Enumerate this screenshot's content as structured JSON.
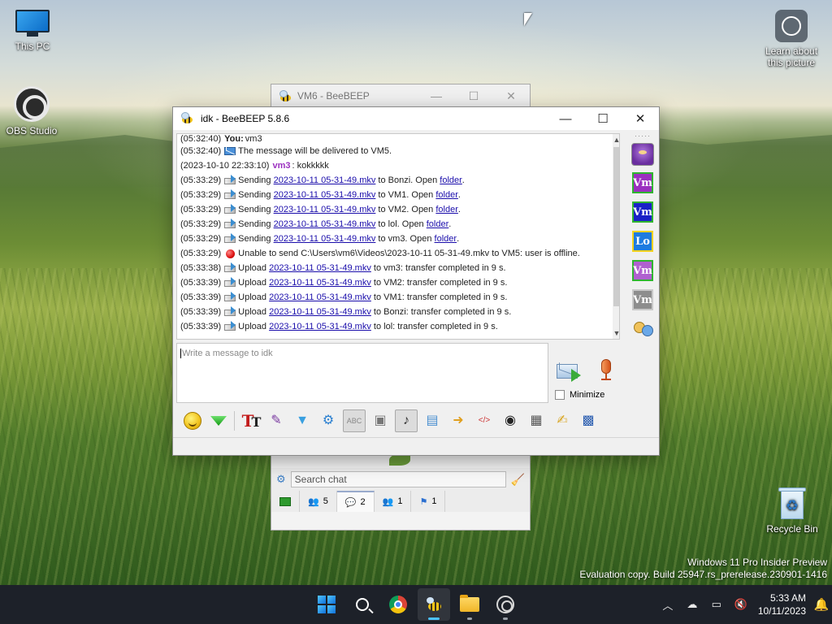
{
  "desktop": {
    "icons": {
      "this_pc": "This PC",
      "obs": "OBS Studio",
      "learn": "Learn about this picture",
      "recycle_bin": "Recycle Bin"
    },
    "watermark": {
      "line1": "Windows 11 Pro Insider Preview",
      "line2": "Evaluation copy. Build 25947.rs_prerelease.230901-1416"
    }
  },
  "background_window": {
    "title": "VM6 - BeeBEEP",
    "search_placeholder": "Search chat",
    "tabs": [
      {
        "count": ""
      },
      {
        "count": "5"
      },
      {
        "count": "2"
      },
      {
        "count": "1"
      },
      {
        "count": "1"
      }
    ]
  },
  "main_window": {
    "title": "idk - BeeBEEP 5.8.6",
    "controls": {
      "minimize": "—",
      "maximize": "☐",
      "close": "✕"
    },
    "chat": {
      "lines": [
        {
          "ts": "(05:32:40)",
          "nick": "You:",
          "text": "vm3"
        },
        {
          "ts": "(05:32:40)",
          "text": "The message will be delivered to VM5."
        },
        {
          "ts": "(2023-10-10 22:33:10)",
          "nick": "vm3",
          "text": ": kokkkkk"
        },
        {
          "ts": "(05:33:29)",
          "pre": "Sending",
          "file": "2023-10-11 05-31-49.mkv",
          "mid": "to Bonzi. Open",
          "link": "folder",
          "post": "."
        },
        {
          "ts": "(05:33:29)",
          "pre": "Sending",
          "file": "2023-10-11 05-31-49.mkv",
          "mid": "to VM1. Open",
          "link": "folder",
          "post": "."
        },
        {
          "ts": "(05:33:29)",
          "pre": "Sending",
          "file": "2023-10-11 05-31-49.mkv",
          "mid": "to VM2. Open",
          "link": "folder",
          "post": "."
        },
        {
          "ts": "(05:33:29)",
          "pre": "Sending",
          "file": "2023-10-11 05-31-49.mkv",
          "mid": "to lol. Open",
          "link": "folder",
          "post": "."
        },
        {
          "ts": "(05:33:29)",
          "pre": "Sending",
          "file": "2023-10-11 05-31-49.mkv",
          "mid": "to vm3. Open",
          "link": "folder",
          "post": "."
        },
        {
          "ts": "(05:33:29)",
          "text": "Unable to send C:\\Users\\vm6\\Videos\\2023-10-11 05-31-49.mkv to VM5: user is offline."
        },
        {
          "ts": "(05:33:38)",
          "pre": "Upload",
          "file": "2023-10-11 05-31-49.mkv",
          "mid": "to vm3: transfer completed in 9 s."
        },
        {
          "ts": "(05:33:39)",
          "pre": "Upload",
          "file": "2023-10-11 05-31-49.mkv",
          "mid": "to VM2: transfer completed in 9 s."
        },
        {
          "ts": "(05:33:39)",
          "pre": "Upload",
          "file": "2023-10-11 05-31-49.mkv",
          "mid": "to VM1: transfer completed in 9 s."
        },
        {
          "ts": "(05:33:39)",
          "pre": "Upload",
          "file": "2023-10-11 05-31-49.mkv",
          "mid": "to Bonzi: transfer completed in 9 s."
        },
        {
          "ts": "(05:33:39)",
          "pre": "Upload",
          "file": "2023-10-11 05-31-49.mkv",
          "mid": "to lol: transfer completed in 9 s."
        }
      ]
    },
    "users": [
      {
        "label": "Vm",
        "status": "online"
      },
      {
        "label": "Vm",
        "status": "online"
      },
      {
        "label": "Lo",
        "status": "away"
      },
      {
        "label": "Vm",
        "status": "online"
      },
      {
        "label": "Vm",
        "status": "offline"
      }
    ],
    "compose": {
      "placeholder": "Write a message to idk",
      "minimize_label": "Minimize"
    }
  },
  "taskbar": {
    "time": "5:33 AM",
    "date": "10/11/2023"
  },
  "colors": {
    "link": "#1a0dab",
    "nick": "#9b30c0",
    "taskbar": "#1d2129",
    "accent": "#4cc2ff"
  }
}
